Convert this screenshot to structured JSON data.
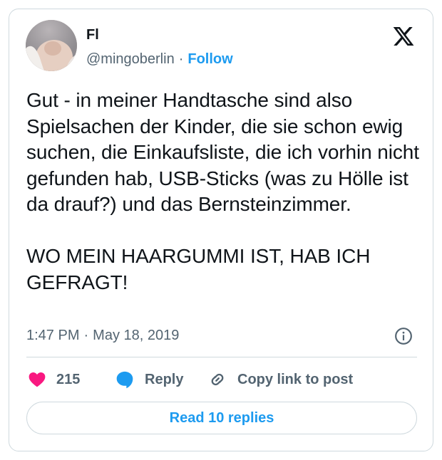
{
  "tweet": {
    "author": {
      "display_name": "Fl",
      "handle": "@mingoberlin",
      "separator": "·",
      "follow_label": "Follow"
    },
    "text": "Gut - in meiner Handtasche sind also Spielsachen der Kinder, die sie schon ewig suchen, die Einkaufsliste, die ich vorhin nicht gefunden hab, USB-Sticks (was zu Hölle ist da drauf?) und das Bernsteinzimmer.\n\nWO MEIN HAARGUMMI IST, HAB ICH GEFRAGT!",
    "time": "1:47 PM",
    "date_separator": "·",
    "date": "May 18, 2019",
    "actions": {
      "like_count": "215",
      "reply_label": "Reply",
      "copy_link_label": "Copy link to post"
    },
    "read_replies_label": "Read 10 replies"
  },
  "icons": {
    "brand": "x-logo-icon",
    "info": "info-icon",
    "like": "heart-icon",
    "reply": "speech-bubble-icon",
    "copy_link": "link-icon"
  },
  "colors": {
    "accent": "#1d9bf0",
    "like": "#f91880",
    "text_primary": "#0f1419",
    "text_secondary": "#536471",
    "border": "#cfd9de"
  }
}
